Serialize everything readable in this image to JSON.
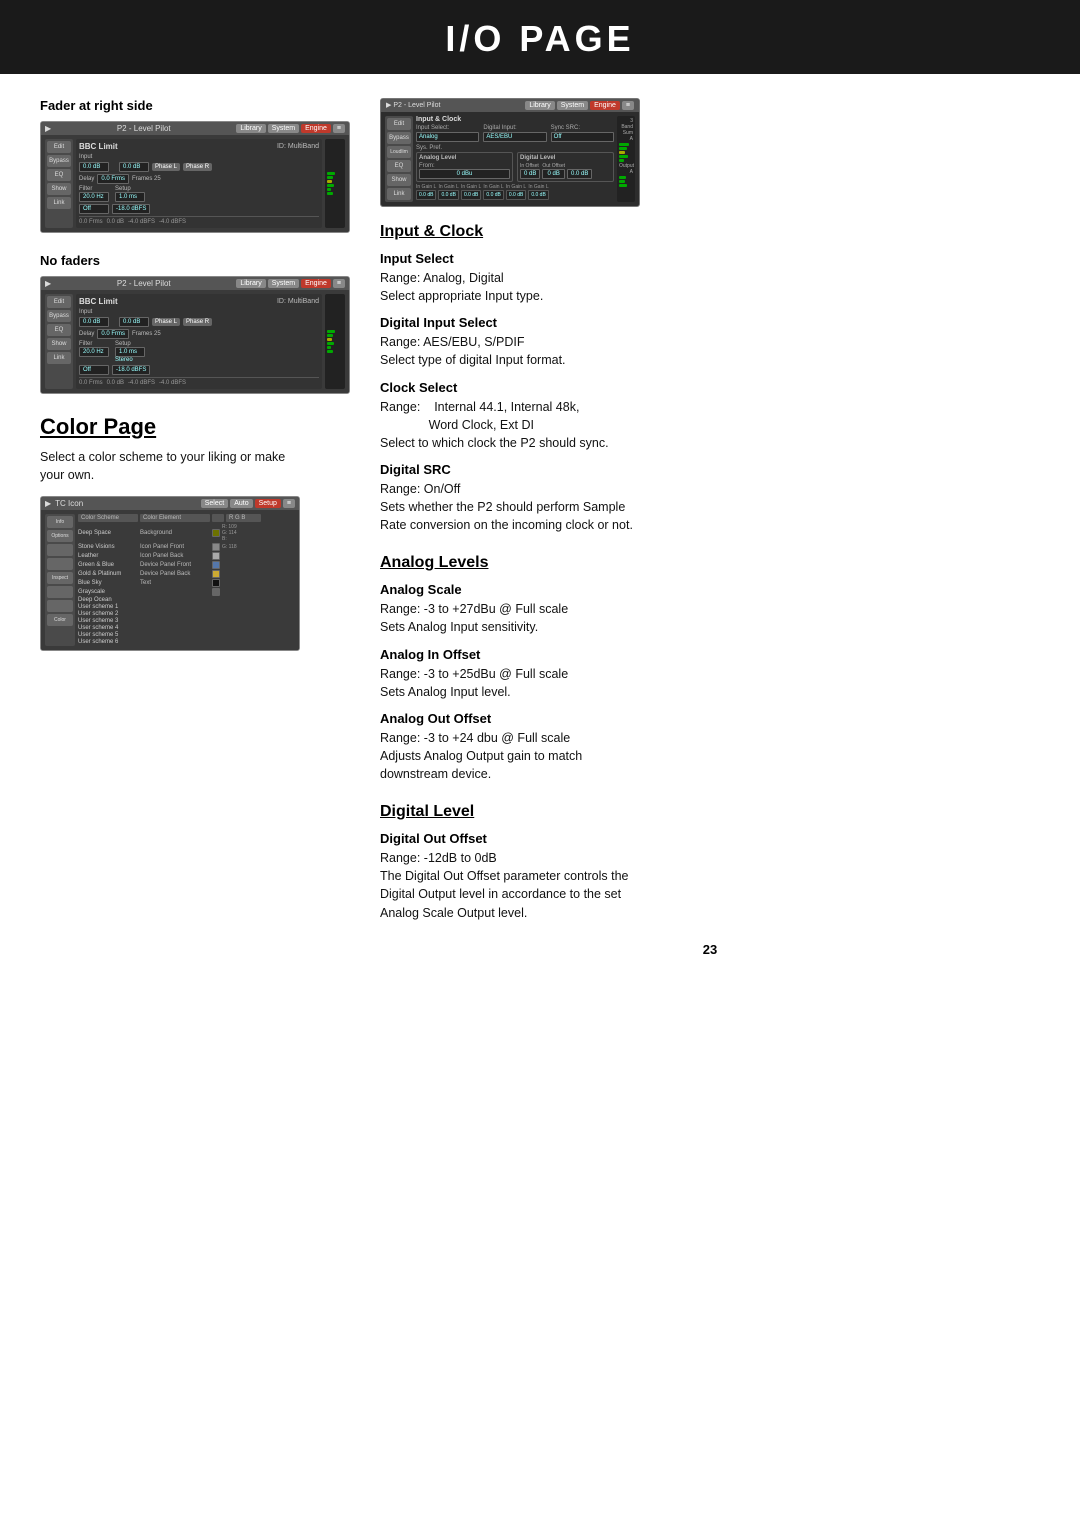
{
  "header": {
    "title": "I/O PAGE"
  },
  "left_column": {
    "fader_section": {
      "label": "Fader at right side",
      "device1": {
        "top_label": "P2 - Level Pilot",
        "nav_buttons": [
          "Library",
          "System",
          "Engine"
        ],
        "section": "BBC Limit",
        "id_label": "ID: MultiBand",
        "subsection": "Input",
        "value1": "0.0 dB",
        "value2": "0.0 dB",
        "delay_label": "Delay",
        "delay_value": "0.0 Frms",
        "frames_label": "Frames 25",
        "filter_label": "Filter",
        "filter_hz": "20.0 Hz",
        "setup_label": "Setup",
        "setup_ms": "1.0 ms",
        "off_label": "Off",
        "off_db": "-18.0 dBFS",
        "status_row": "0.0 Frms  0.0 dB  -4.0 dBFS  -4.0 dBFS"
      }
    },
    "no_faders_section": {
      "label": "No faders",
      "device2": {
        "top_label": "P2 - Level Pilot",
        "nav_buttons": [
          "Library",
          "System",
          "Engine"
        ],
        "section": "BBC Limit",
        "id_label": "ID: MultiBand",
        "subsection": "Input",
        "value1": "0.0 dB",
        "value2": "0.0 dB",
        "delay_label": "Delay",
        "delay_value": "0.0 Frms",
        "frames_label": "Frames 25",
        "filter_label": "Filter",
        "filter_hz": "20.0 Hz",
        "setup_label": "Setup",
        "setup_ms": "1.0 ms",
        "stereo_label": "Stereo",
        "off_label": "Off",
        "off_db": "-18.0 dBFS",
        "status_row": "0.0 Frms  0.0 dB  -4.0 dBFS  -4.0 dBFS"
      }
    },
    "color_page_section": {
      "heading": "Color Page",
      "description_line1": "Select a color scheme to your liking or make",
      "description_line2": "your own.",
      "device3": {
        "top_label": "TC Icon",
        "nav_buttons": [
          "Select",
          "Auto",
          "Setup"
        ],
        "table_headers": [
          "Color Scheme",
          "Color Element",
          "",
          "R G B"
        ],
        "rows": [
          {
            "scheme": "Deep Space",
            "element": "Background",
            "r": "109",
            "g": "114",
            "b": "",
            "color": "#6d7200"
          },
          {
            "scheme": "Stone Visions",
            "element": "Icon Panel Front",
            "r": "",
            "g": "118",
            "b": "",
            "color": "#888"
          },
          {
            "scheme": "Leather",
            "element": "Icon Panel Back",
            "r": "",
            "g": "",
            "b": "",
            "color": "#aaa"
          },
          {
            "scheme": "Green & Blue",
            "element": "Device Panel Front",
            "r": "",
            "g": "",
            "b": "",
            "color": "#5577aa"
          },
          {
            "scheme": "Gold & Platinum",
            "element": "Device Panel Back",
            "r": "",
            "g": "",
            "b": "",
            "color": "#ccaa33"
          },
          {
            "scheme": "Blue Sky",
            "element": "Text",
            "r": "",
            "g": "",
            "b": "",
            "color": "#000"
          },
          {
            "scheme": "Grayscale",
            "element": "",
            "r": "",
            "g": "",
            "b": "",
            "color": "#666"
          },
          {
            "scheme": "Deep Ocean",
            "element": "",
            "r": "",
            "g": "",
            "b": "",
            "color": "#224488"
          },
          {
            "scheme": "User scheme 1",
            "element": "",
            "r": "",
            "g": "",
            "b": "",
            "color": "#888"
          },
          {
            "scheme": "User scheme 2",
            "element": "",
            "r": "",
            "g": "",
            "b": "",
            "color": "#888"
          },
          {
            "scheme": "User scheme 3",
            "element": "",
            "r": "",
            "g": "",
            "b": "",
            "color": "#888"
          },
          {
            "scheme": "User scheme 4",
            "element": "",
            "r": "",
            "g": "",
            "b": "",
            "color": "#888"
          },
          {
            "scheme": "User scheme 5",
            "element": "",
            "r": "",
            "g": "",
            "b": "",
            "color": "#888"
          },
          {
            "scheme": "User scheme 6",
            "element": "",
            "r": "",
            "g": "",
            "b": "",
            "color": "#888"
          }
        ]
      }
    }
  },
  "right_column": {
    "io_device": {
      "top_label": "P2 - Level Pilot",
      "nav_buttons": [
        "Library",
        "System",
        "Engine"
      ],
      "section_title": "Input & Clock",
      "input_label": "Input Select:",
      "input_value": "Analog",
      "digital_label": "Digital Input:",
      "digital_value": "AES/EBU",
      "src_label": "Sync SRC:",
      "src_value": "Off",
      "analog_level_title": "Analog Level",
      "analog_value": "0 dBu",
      "digital_level_title": "Digital Level",
      "offset1_label": "In Offset",
      "offset1_value": "0 dB",
      "offset2_label": "Out Offset",
      "offset2_value": "0 dB",
      "digital_offset": "0.0 dB",
      "bottom_labels": [
        "In Gain L",
        "In Gain L",
        "In Gain L",
        "In Gain L",
        "In Gain L",
        "In Gain L"
      ],
      "bottom_values": [
        "0.0 dB",
        "0.0 dB",
        "0.0 dB",
        "0.0 dB",
        "0.0 dB",
        "0.0 dB"
      ]
    },
    "input_clock": {
      "heading": "Input & Clock",
      "subsections": [
        {
          "title": "Input Select",
          "range": "Range: Analog, Digital",
          "description": "Select appropriate Input type."
        },
        {
          "title": "Digital Input Select",
          "range": "Range: AES/EBU, S/PDIF",
          "description": "Select type of digital Input format."
        },
        {
          "title": "Clock Select",
          "range_label": "Range:",
          "range_value": "Internal 44.1, Internal 48k,",
          "range_value2": "Word Clock, Ext DI",
          "description": "Select to which clock the P2 should sync."
        },
        {
          "title": "Digital SRC",
          "range": "Range: On/Off",
          "description_line1": "Sets whether the P2 should perform Sample",
          "description_line2": "Rate conversion on the incoming clock or not."
        }
      ]
    },
    "analog_levels": {
      "heading": "Analog Levels",
      "subsections": [
        {
          "title": "Analog Scale",
          "range": "Range: -3 to +27dBu @ Full scale",
          "description": "Sets Analog Input sensitivity."
        },
        {
          "title": "Analog In Offset",
          "range": "Range: -3 to +25dBu @ Full scale",
          "description": "Sets Analog Input level."
        },
        {
          "title": "Analog Out Offset",
          "range": "Range: -3 to +24 dbu @ Full scale",
          "description_line1": "Adjusts Analog Output gain to match",
          "description_line2": "downstream device."
        }
      ]
    },
    "digital_level": {
      "heading": "Digital Level",
      "subsections": [
        {
          "title": "Digital Out Offset",
          "range": "Range: -12dB to 0dB",
          "description_line1": "The Digital Out Offset parameter controls the",
          "description_line2": "Digital Output level in accordance to the set",
          "description_line3": "Analog Scale Output level."
        }
      ]
    }
  },
  "page_number": "23"
}
